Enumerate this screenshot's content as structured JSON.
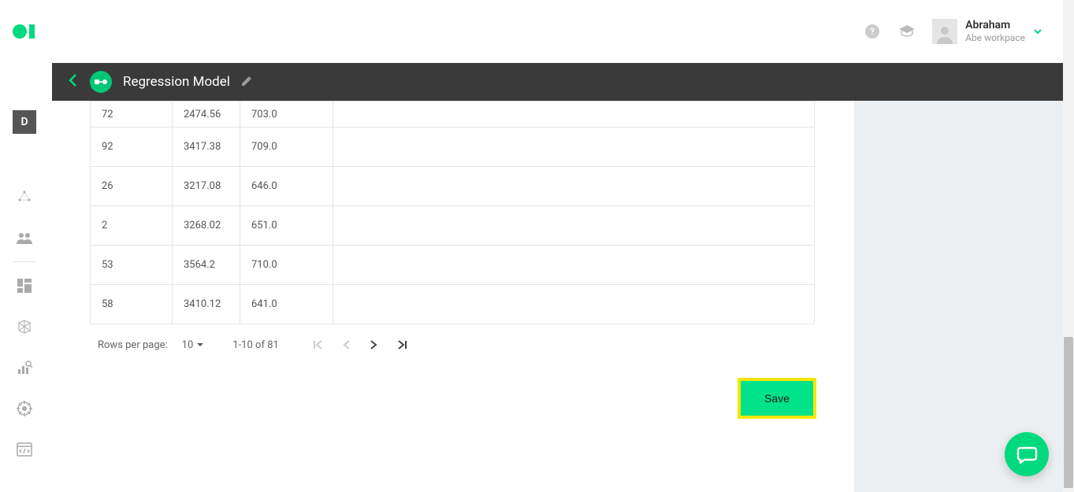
{
  "header": {
    "user_name": "Abraham",
    "workspace": "Abe workpace"
  },
  "leftRail": {
    "badge": "D"
  },
  "titlebar": {
    "title": "Regression Model"
  },
  "table": {
    "rows": [
      {
        "a": "72",
        "b": "2474.56",
        "c": "703.0"
      },
      {
        "a": "92",
        "b": "3417.38",
        "c": "709.0"
      },
      {
        "a": "26",
        "b": "3217.08",
        "c": "646.0"
      },
      {
        "a": "2",
        "b": "3268.02",
        "c": "651.0"
      },
      {
        "a": "53",
        "b": "3564.2",
        "c": "710.0"
      },
      {
        "a": "58",
        "b": "3410.12",
        "c": "641.0"
      }
    ]
  },
  "pagination": {
    "rows_label": "Rows per page:",
    "rows_value": "10",
    "range": "1-10 of 81"
  },
  "actions": {
    "save": "Save"
  }
}
